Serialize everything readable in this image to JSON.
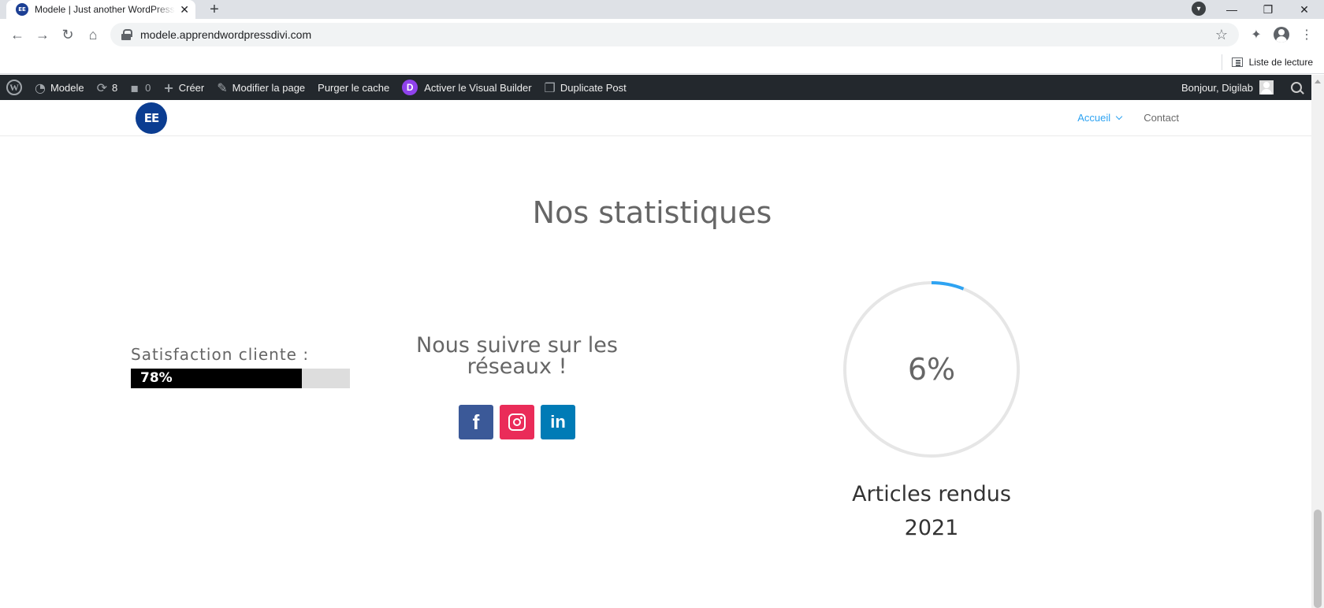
{
  "browser": {
    "tab_title": "Modele | Just another WordPress site",
    "tab_favicon": "EE",
    "url": "modele.apprendwordpressdivi.com",
    "reading_list": "Liste de lecture"
  },
  "adminbar": {
    "site_name": "Modele",
    "updates_count": "8",
    "comments_count": "0",
    "new_label": "Créer",
    "edit_label": "Modifier la page",
    "purge_label": "Purger le cache",
    "visual_builder_label": "Activer le Visual Builder",
    "duplicate_label": "Duplicate Post",
    "greeting": "Bonjour, Digilab"
  },
  "header": {
    "logo_text": "EE",
    "menu": [
      {
        "label": "Accueil",
        "active": true
      },
      {
        "label": "Contact",
        "active": false
      }
    ]
  },
  "main": {
    "section_title": "Nos statistiques",
    "bar": {
      "label": "Satisfaction cliente :",
      "value_text": "78%",
      "percent": 78
    },
    "social": {
      "title": "Nous suivre sur les réseaux !",
      "networks": [
        {
          "name": "facebook",
          "glyph": "f",
          "color": "#3b5998"
        },
        {
          "name": "instagram",
          "glyph": "",
          "color": "#ea2c59"
        },
        {
          "name": "linkedin",
          "glyph": "in",
          "color": "#007bb6"
        }
      ]
    },
    "counter": {
      "value_text": "6%",
      "percent": 6,
      "title_line1": "Articles rendus",
      "title_line2": "2021",
      "track_color": "#e6e6e6",
      "accent_color": "#2ea3f2"
    }
  }
}
